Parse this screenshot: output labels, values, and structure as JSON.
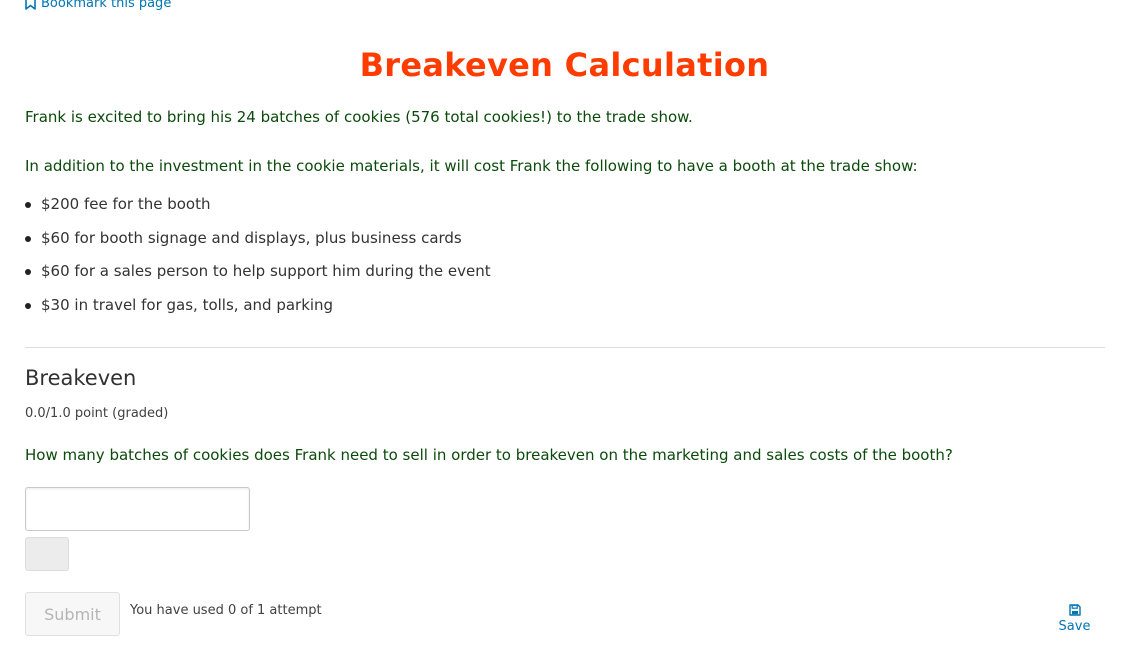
{
  "bookmark": {
    "label": "Bookmark this page",
    "icon": "bookmark-icon"
  },
  "unit": {
    "title": "Breakeven Calculation",
    "intro": "Frank is excited to bring his 24 batches of cookies (576 total cookies!) to the trade show.",
    "costs_intro": "In addition to the investment in the cookie materials, it will cost Frank the following to have a booth at the trade show:",
    "costs": [
      "$200 fee for the booth",
      "$60 for booth signage and displays, plus business cards",
      "$60 for a sales person to help support him during the event",
      "$30 in travel for gas, tolls, and parking"
    ]
  },
  "problem": {
    "title": "Breakeven",
    "score": "0.0/1.0 point (graded)",
    "question": "How many batches of cookies does Frank need to sell in order to breakeven on the marketing and sales costs of the booth?",
    "answer_value": "",
    "submit_label": "Submit",
    "attempts": "You have used 0 of 1 attempt",
    "save_label": "Save",
    "save_icon": "save-icon"
  },
  "colors": {
    "title": "#ff3c00",
    "link": "#0075b4",
    "green_text": "#0b4a0b"
  }
}
